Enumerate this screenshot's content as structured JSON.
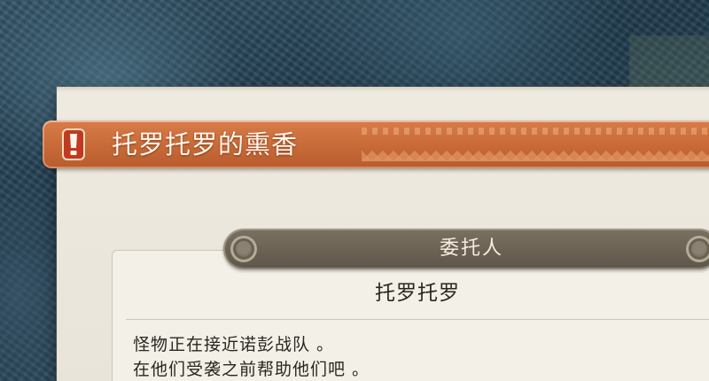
{
  "quest": {
    "title": "托罗托罗的熏香",
    "icon": "quest-flask-icon",
    "accent_color": "#c76a38"
  },
  "client": {
    "header_label": "委托人",
    "name": "托罗托罗"
  },
  "description": {
    "lines": [
      "怪物正在接近诺彭战队 。",
      "在他们受袭之前帮助他们吧 。"
    ]
  }
}
